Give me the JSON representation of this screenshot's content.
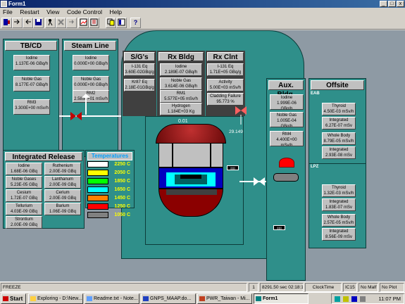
{
  "window": {
    "title": "Form1",
    "min": "_",
    "max": "□",
    "close": "x"
  },
  "menu": [
    "File",
    "Restart",
    "View",
    "Code Control",
    "Help"
  ],
  "toolbar": {
    "icons": [
      "door-icon",
      "arrow-icon",
      "back-icon",
      "save-icon",
      "print-icon",
      "run-icon",
      "stop-icon",
      "step-icon",
      "chart-icon",
      "data-icon",
      "list-icon",
      "copy-icon",
      "help-icon"
    ],
    "help": "?"
  },
  "tbcd": {
    "title": "TB/CD",
    "iodine": [
      "Iodine",
      "1.137E-06 GBq/h"
    ],
    "noble": [
      "Noble Gas",
      "8.177E-07 GBq/h"
    ],
    "rm3": [
      "RM3",
      "3.300E+00 mSv/h"
    ]
  },
  "steam": {
    "title": "Steam Line",
    "iodine": [
      "Iodine",
      "0.000E+00 GBq/h"
    ],
    "noble": [
      "Noble Gas",
      "0.000E+00 GBq/h"
    ],
    "rm2": [
      "RM2",
      "2.585E+01 mSv/h"
    ]
  },
  "sg": {
    "title": "S/G's",
    "i131": [
      "I-131 Eq",
      "3.60E-02GBq/g"
    ],
    "kr87": [
      "Kr87 Eq",
      "2.18E-01GBq/g"
    ]
  },
  "rxbldg": {
    "title": "Rx Bldg",
    "iodine": [
      "Iodine",
      "2.189E-07 GBq/h"
    ],
    "noble": [
      "Noble Gas",
      "3.614E-06 GBq/h"
    ],
    "rm1": [
      "RM1",
      "5.577E+05 mSv/h"
    ],
    "hydrogen": [
      "Hydrogen",
      "1.184E+03 Kg"
    ]
  },
  "rxclnt": {
    "title": "Rx Clnt",
    "i131": [
      "I-131 Eq",
      "1.71E+05 GBq/g"
    ],
    "activity": [
      "Activity",
      "5.00E+03 mSv/h"
    ],
    "cladding": [
      "Cladding Failure",
      "95.773 %"
    ]
  },
  "aux": {
    "title": "Aux. Bldg.",
    "iodine": [
      "Iodine",
      "1.999E-06 GBq/h"
    ],
    "noble": [
      "Noble Gas",
      "1.005E-04 GBq/h"
    ],
    "rm4": [
      "RM4",
      "4.400E+00 mSv/h"
    ]
  },
  "offsite": {
    "title": "Offsite",
    "eab": {
      "label": "EAB",
      "thyroid": [
        "Thyroid",
        "4.50E-03 mSv/h"
      ],
      "thyroid_int": [
        "Integrated",
        "6.27E-07 mSv"
      ],
      "wb": [
        "Whole Body",
        "8.79E-05 mSv/h"
      ],
      "wb_int": [
        "Integrated",
        "2.93E-08 mSv"
      ]
    },
    "lpz": {
      "label": "LPZ",
      "thyroid": [
        "Thyroid",
        "1.32E-03 mSv/h"
      ],
      "thyroid_int": [
        "Integrated",
        "1.83E-07 mSv"
      ],
      "wb": [
        "Whole Body",
        "2.57E-05 mSv/h"
      ],
      "wb_int": [
        "Integrated",
        "8.56E-09 mSv"
      ]
    }
  },
  "release": {
    "title": "Integrated Release",
    "items": [
      [
        "Iodine",
        "1.68E-06 GBq"
      ],
      [
        "Ruthenium",
        "2.00E-09 GBq"
      ],
      [
        "Noble Gases",
        "5.23E-05 GBq"
      ],
      [
        "Lanthanum",
        "2.00E-09 GBq"
      ],
      [
        "Cesium",
        "1.72E-07 GBq"
      ],
      [
        "Cerium",
        "2.00E-09 GBq"
      ],
      [
        "Tellurium",
        "4.03E-09 GBq"
      ],
      [
        "Barium",
        "1.06E-09 GBq"
      ],
      [
        "Strontium",
        "2.00E-09 GBq"
      ]
    ]
  },
  "temps": {
    "title": "Temperatures",
    "rows": [
      {
        "color": "#ffffff",
        "label": "2250 C"
      },
      {
        "color": "#ffff00",
        "label": "2050 C"
      },
      {
        "color": "#00ff00",
        "label": "1850 C"
      },
      {
        "color": "#00ffff",
        "label": "1650 C"
      },
      {
        "color": "#ff8000",
        "label": "1450 C"
      },
      {
        "color": "#ff0000",
        "label": "1250 C"
      },
      {
        "color": "#808080",
        "label": "1050 C"
      }
    ]
  },
  "reactor": {
    "top_value": "0.01",
    "valve_value": "29.149"
  },
  "status": {
    "state": "FREEZE",
    "num": "1",
    "time": "8291.50 sec 02:18:11",
    "clock": "ClockTime",
    "ic": "IC15",
    "malf": "No Malf",
    "plot": "No Plot"
  },
  "taskbar": {
    "start": "Start",
    "tasks": [
      "Exploring - D:\\New...",
      "Readme.txt - Note...",
      "GNPS_MAAP.do...",
      "PWR_Taiwan - Mi...",
      "Form1"
    ],
    "time": "11:07 PM"
  }
}
